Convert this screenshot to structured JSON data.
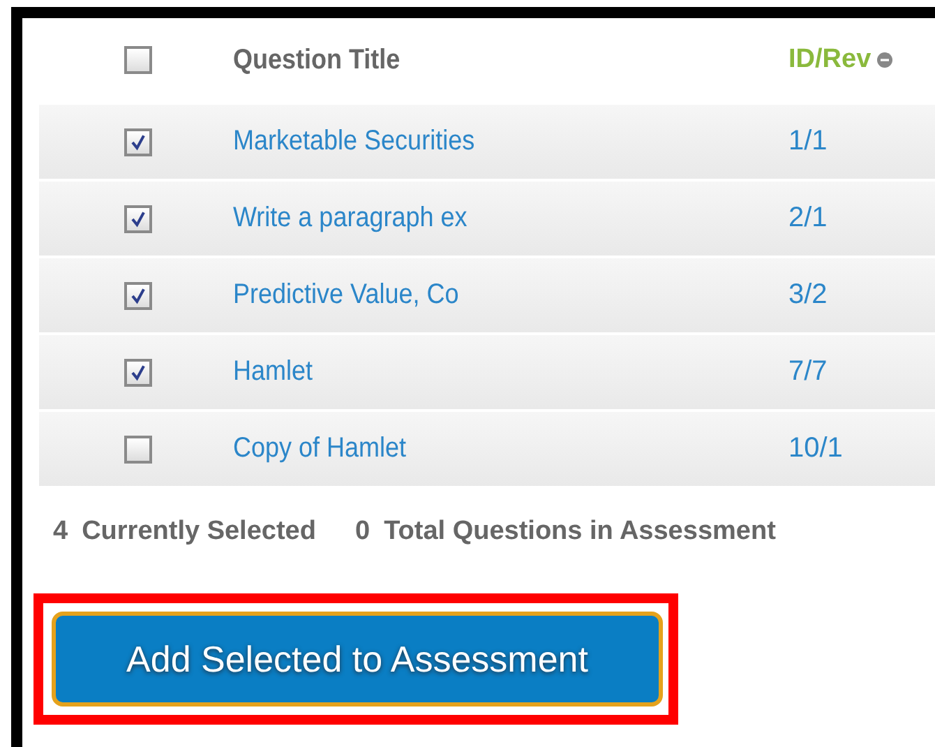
{
  "table": {
    "header": {
      "checked": false,
      "title": "Question Title",
      "id_rev": "ID/Rev"
    },
    "rows": [
      {
        "checked": true,
        "title": "Marketable Securities",
        "id_rev": "1/1"
      },
      {
        "checked": true,
        "title": "Write a paragraph ex",
        "id_rev": "2/1"
      },
      {
        "checked": true,
        "title": "Predictive Value, Co",
        "id_rev": "3/2"
      },
      {
        "checked": true,
        "title": "Hamlet",
        "id_rev": "7/7"
      },
      {
        "checked": false,
        "title": "Copy of Hamlet",
        "id_rev": "10/1"
      }
    ]
  },
  "summary": {
    "selected_count": "4",
    "selected_label": "Currently Selected",
    "total_count": "0",
    "total_label": "Total Questions in Assessment"
  },
  "add_button": {
    "label": "Add Selected to Assessment",
    "highlighted": true
  }
}
